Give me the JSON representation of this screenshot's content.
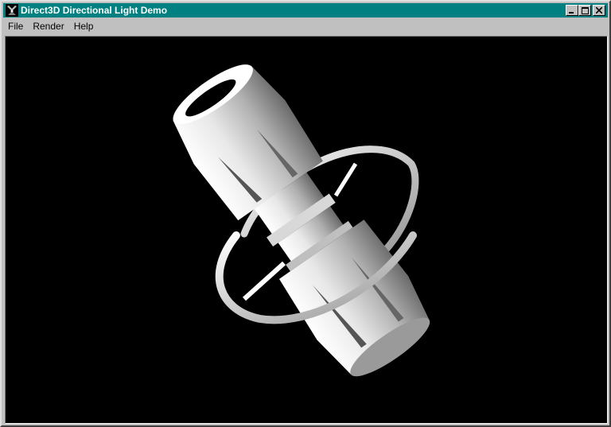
{
  "window": {
    "title": "Direct3D Directional Light Demo",
    "titlebar_color": "#008080",
    "buttons": [
      "minimize",
      "maximize",
      "close"
    ]
  },
  "menu": {
    "items": [
      {
        "label": "File"
      },
      {
        "label": "Render"
      },
      {
        "label": "Help"
      }
    ]
  },
  "viewport": {
    "background": "#000000",
    "scene": "lit 3D model with rings"
  }
}
